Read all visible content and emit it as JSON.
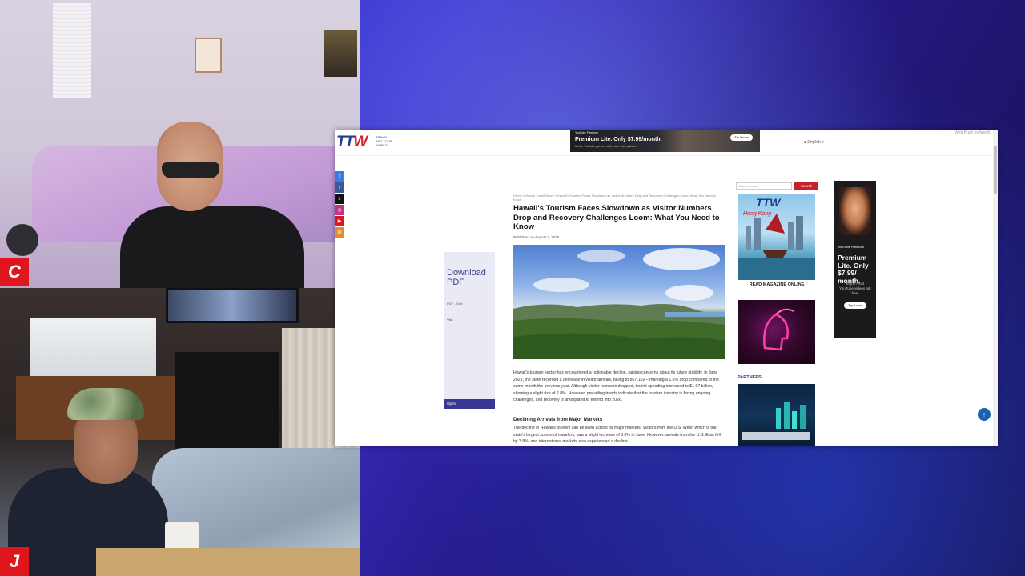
{
  "webcams": {
    "top_badge": "C",
    "bottom_badge": "J",
    "mid_badge_icon": "monitor-icon",
    "mid_badge_letter": "C"
  },
  "site": {
    "logo": {
      "main": "TT",
      "accent": "W",
      "tagline": "TRAVEL AND TOUR WORLD"
    },
    "language": "English",
    "top_right": "Web Push by feedify",
    "top_ad": {
      "brand": "YouTube Premium",
      "headline": "Premium Lite. Only $7.99/month.",
      "sub": "It's the YouTube you love with fewer interruptions.",
      "cta": "Try it now"
    },
    "share_icons": [
      "share-icon",
      "facebook-icon",
      "x-icon",
      "instagram-icon",
      "youtube-icon",
      "email-icon"
    ]
  },
  "article": {
    "breadcrumb": "Home » Hawaii Travel News » Hawaii's Tourism Faces Slowdown as Visitor Numbers Drop and Recovery Challenges Loom: What You Need to Know",
    "headline": "Hawaii's Tourism Faces Slowdown as Visitor Numbers Drop and Recovery Challenges Loom: What You Need to Know",
    "byline": "Published on August 2, 2025",
    "paragraph1": "Hawaii's tourism sector has encountered a noticeable decline, raising concerns about its future stability. In June 2025, the state recorded a decrease in visitor arrivals, falling to 857,102 – marking a 1.8% drop compared to the same month the previous year. Although visitor numbers dropped, tourist spending increased to $1.97 billion, showing a slight rise of 2.8%. However, prevailing trends indicate that the tourism industry is facing ongoing challenges, and recovery is anticipated to extend into 2026.",
    "subheading": "Declining Arrivals from Major Markets",
    "paragraph2": "The decline in Hawaii's tourism can be seen across its major markets. Visitors from the U.S. West, which is the state's largest source of travelers, saw a slight increase of 3.8% in June. However, arrivals from the U.S. East fell by 3.8%, and international markets also experienced a decline."
  },
  "left_ad": {
    "title": "Download PDF",
    "source": "PDF - Smlt",
    "link": "Visit",
    "cta": "Open"
  },
  "sidebar": {
    "search_placeholder": "Search news",
    "search_button": "Search",
    "magazine_label": "READ MAGAZINE ONLINE",
    "magazine_logo": "TTW",
    "magazine_feature": "Hong Kong",
    "partners_label": "PARTNERS"
  },
  "right_ad": {
    "brand": "YouTube Premium",
    "headline": "Premium Lite. Only $7.99/ month.",
    "sub": "Enjoy most YouTube videos ad-free.",
    "cta": "Try it now"
  },
  "colors": {
    "brand_blue": "#1d3d8f",
    "brand_red": "#d4202e",
    "search_red": "#c8202a",
    "badge_red": "#e0161d"
  }
}
